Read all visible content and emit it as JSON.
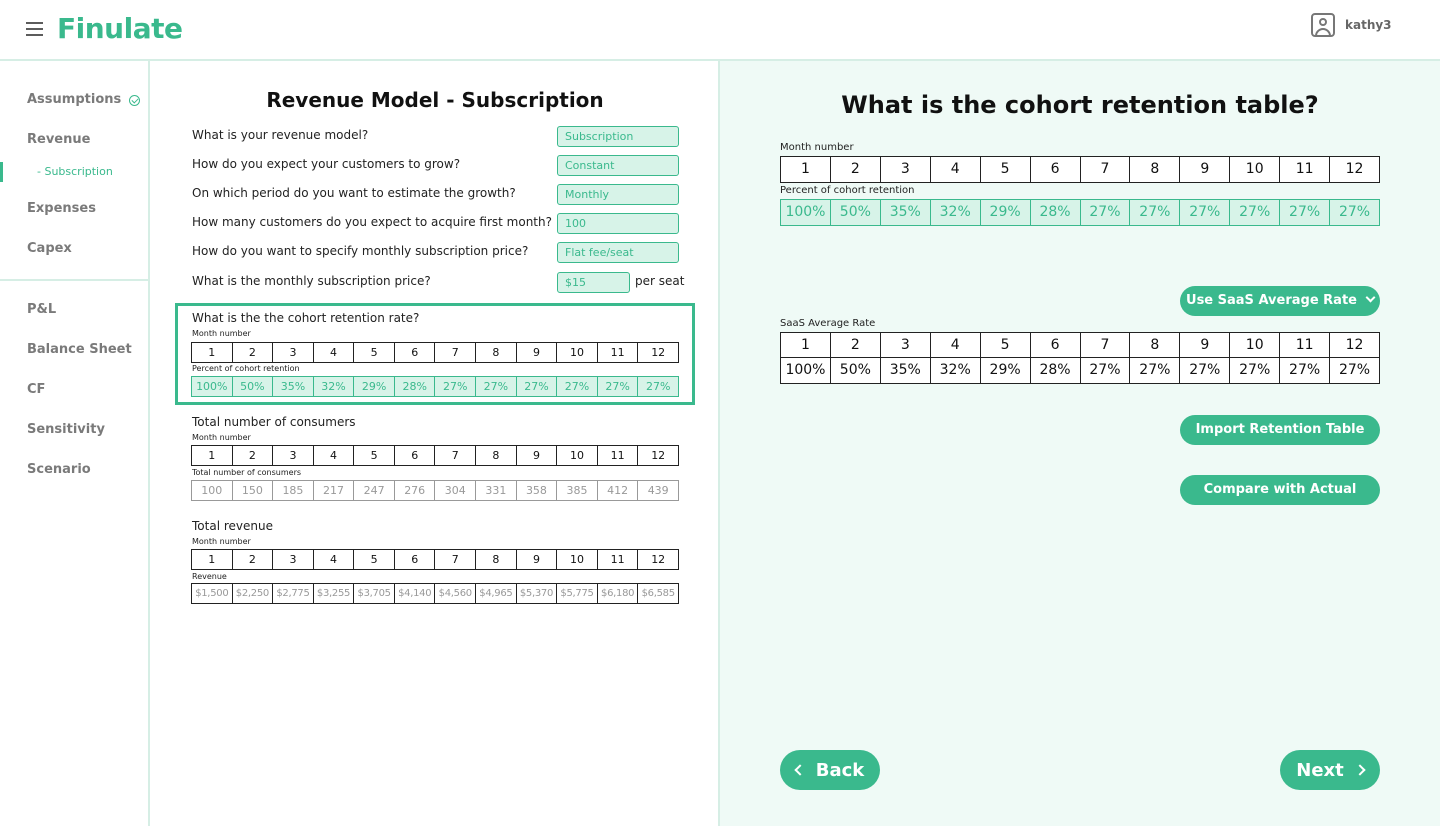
{
  "app": {
    "logo": "Finulate",
    "username": "kathy3"
  },
  "sidebar": {
    "items": [
      {
        "label": "Assumptions",
        "done": true
      },
      {
        "label": "Revenue"
      },
      {
        "label": "- Subscription",
        "sub": true,
        "active": true
      },
      {
        "label": "Expenses"
      },
      {
        "label": "Capex"
      },
      {
        "label": "P&L"
      },
      {
        "label": "Balance Sheet"
      },
      {
        "label": "CF"
      },
      {
        "label": "Sensitivity"
      },
      {
        "label": "Scenario"
      }
    ]
  },
  "form": {
    "title": "Revenue Model - Subscription",
    "questions": [
      {
        "label": "What is your revenue model?",
        "value": "Subscription"
      },
      {
        "label": "How do you expect your customers to grow?",
        "value": "Constant"
      },
      {
        "label": "On which period do you want to estimate the growth?",
        "value": "Monthly"
      },
      {
        "label": "How many customers do you expect to acquire first month?",
        "value": "100"
      },
      {
        "label": "How do you want to specify monthly subscription price?",
        "value": "Flat fee/seat"
      },
      {
        "label": "What is the monthly subscription price?",
        "value": "$15",
        "suffix": "per seat"
      }
    ],
    "retention": {
      "title": "What is the the cohort retention rate?",
      "month_label": "Month number",
      "value_label": "Percent of cohort retention",
      "months": [
        "1",
        "2",
        "3",
        "4",
        "5",
        "6",
        "7",
        "8",
        "9",
        "10",
        "11",
        "12"
      ],
      "values": [
        "100%",
        "50%",
        "35%",
        "32%",
        "29%",
        "28%",
        "27%",
        "27%",
        "27%",
        "27%",
        "27%",
        "27%"
      ]
    },
    "consumers": {
      "title": "Total number of consumers",
      "month_label": "Month number",
      "value_label": "Total number of consumers",
      "months": [
        "1",
        "2",
        "3",
        "4",
        "5",
        "6",
        "7",
        "8",
        "9",
        "10",
        "11",
        "12"
      ],
      "values": [
        "100",
        "150",
        "185",
        "217",
        "247",
        "276",
        "304",
        "331",
        "358",
        "385",
        "412",
        "439"
      ]
    },
    "revenue": {
      "title": "Total revenue",
      "month_label": "Month number",
      "value_label": "Revenue",
      "months": [
        "1",
        "2",
        "3",
        "4",
        "5",
        "6",
        "7",
        "8",
        "9",
        "10",
        "11",
        "12"
      ],
      "values": [
        "$1,500",
        "$2,250",
        "$2,775",
        "$3,255",
        "$3,705",
        "$4,140",
        "$4,560",
        "$4,965",
        "$5,370",
        "$5,775",
        "$6,180",
        "$6,585"
      ]
    }
  },
  "right": {
    "title": "What is the cohort retention table?",
    "month_label": "Month number",
    "retention_label": "Percent of cohort retention",
    "months": [
      "1",
      "2",
      "3",
      "4",
      "5",
      "6",
      "7",
      "8",
      "9",
      "10",
      "11",
      "12"
    ],
    "retention": [
      "100%",
      "50%",
      "35%",
      "32%",
      "29%",
      "28%",
      "27%",
      "27%",
      "27%",
      "27%",
      "27%",
      "27%"
    ],
    "saas_button": "Use SaaS Average Rate",
    "saas_label": "SaaS Average Rate",
    "saas_values": [
      "100%",
      "50%",
      "35%",
      "32%",
      "29%",
      "28%",
      "27%",
      "27%",
      "27%",
      "27%",
      "27%",
      "27%"
    ],
    "import_button": "Import Retention Table",
    "compare_button": "Compare with Actual",
    "back_button": "Back",
    "next_button": "Next"
  },
  "colors": {
    "accent": "#3ab98d",
    "accent_light": "#d7f3e8",
    "panel_bg": "#effaf6"
  }
}
